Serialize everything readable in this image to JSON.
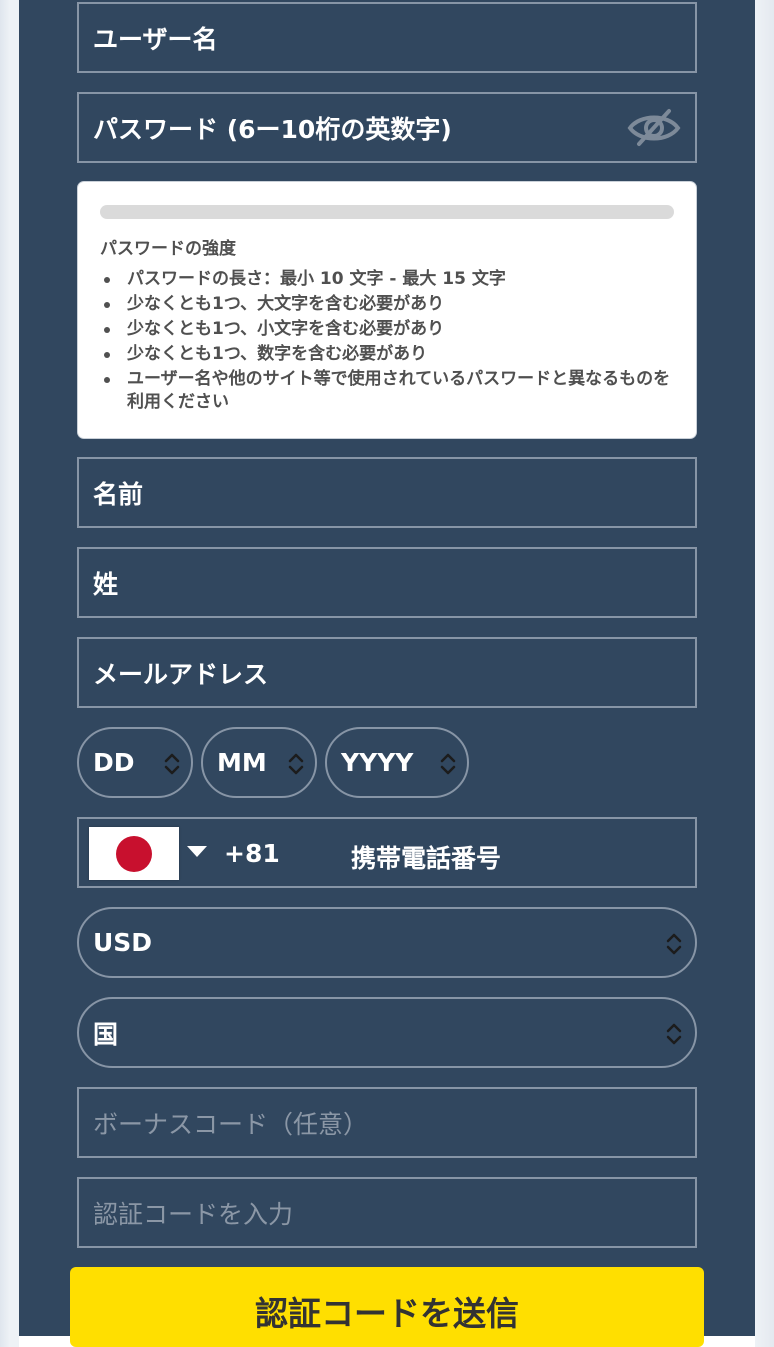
{
  "form": {
    "username_placeholder": "ユーザー名",
    "password_placeholder": "パスワード (6ー10桁の英数字)",
    "password_strength": {
      "title": "パスワードの強度",
      "level": 0,
      "rules": [
        "パスワードの長さ：最小 10 文字 - 最大 15 文字",
        "少なくとも1つ、大文字を含む必要があり",
        "少なくとも1つ、小文字を含む必要があり",
        "少なくとも1つ、数字を含む必要があり",
        "ユーザー名や他のサイト等で使用されているパスワードと異なるものを利用ください"
      ]
    },
    "first_name_placeholder": "名前",
    "last_name_placeholder": "姓",
    "email_placeholder": "メールアドレス",
    "dob": {
      "day": "DD",
      "month": "MM",
      "year": "YYYY"
    },
    "phone": {
      "country_flag": "japan-flag",
      "dial_code": "+81",
      "placeholder": "携帯電話番号"
    },
    "currency": "USD",
    "country": "国",
    "bonus_code_placeholder": "ボーナスコード（任意）",
    "verification_code_placeholder": "認証コードを入力",
    "send_code_button": "認証コードを送信"
  },
  "colors": {
    "panel": "#31475f",
    "cta": "#ffdf00",
    "border": "#8795a6",
    "flag_red": "#c8102e"
  }
}
